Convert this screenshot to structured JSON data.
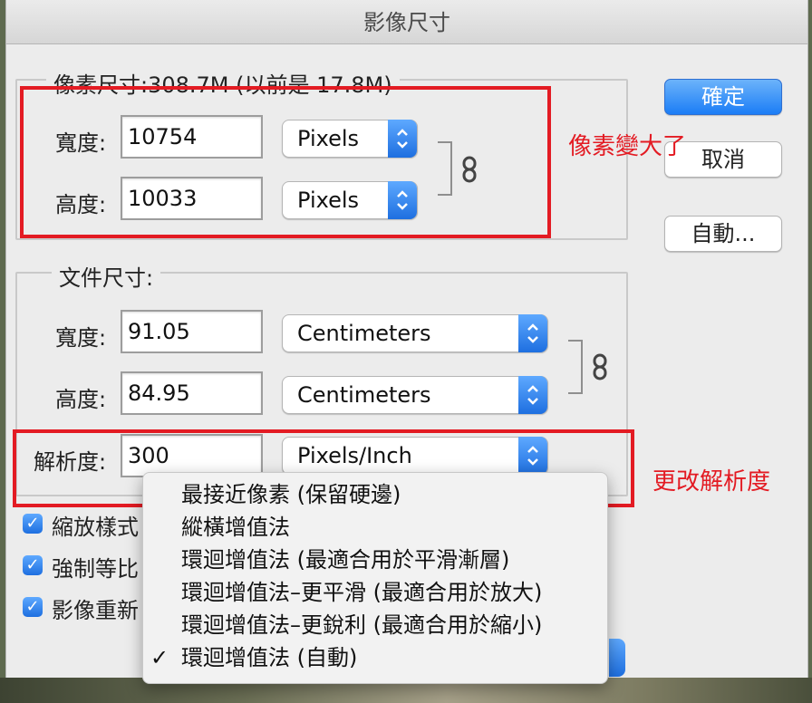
{
  "window": {
    "title": "影像尺寸"
  },
  "pixel_dimensions": {
    "legend": "像素尺寸:308.7M (以前是 17.8M)",
    "width_label": "寬度:",
    "width_value": "10754",
    "width_unit": "Pixels",
    "height_label": "高度:",
    "height_value": "10033",
    "height_unit": "Pixels"
  },
  "document_size": {
    "legend": "文件尺寸:",
    "width_label": "寬度:",
    "width_value": "91.05",
    "width_unit": "Centimeters",
    "height_label": "高度:",
    "height_value": "84.95",
    "height_unit": "Centimeters",
    "resolution_label": "解析度:",
    "resolution_value": "300",
    "resolution_unit": "Pixels/Inch"
  },
  "buttons": {
    "ok": "確定",
    "cancel": "取消",
    "auto": "自動..."
  },
  "checkboxes": [
    {
      "label": "縮放樣式",
      "checked": true
    },
    {
      "label": "強制等比",
      "checked": true
    },
    {
      "label": "影像重新",
      "checked": true
    }
  ],
  "resample_menu": {
    "items": [
      {
        "label": "最接近像素 (保留硬邊)",
        "selected": false
      },
      {
        "label": "縱橫增值法",
        "selected": false
      },
      {
        "label": "環迴增值法 (最適合用於平滑漸層)",
        "selected": false
      },
      {
        "label": "環迴增值法–更平滑 (最適合用於放大)",
        "selected": false
      },
      {
        "label": "環迴增值法–更銳利 (最適合用於縮小)",
        "selected": false
      },
      {
        "label": "環迴增值法 (自動)",
        "selected": true
      }
    ],
    "check_mark": "✓"
  },
  "annotations": {
    "pixels_note": "像素變大了",
    "resolution_note": "更改解析度",
    "color": "#e31b23"
  },
  "icons": {
    "chain": "chain-link-icon",
    "stepper": "up-down-stepper-icon"
  }
}
